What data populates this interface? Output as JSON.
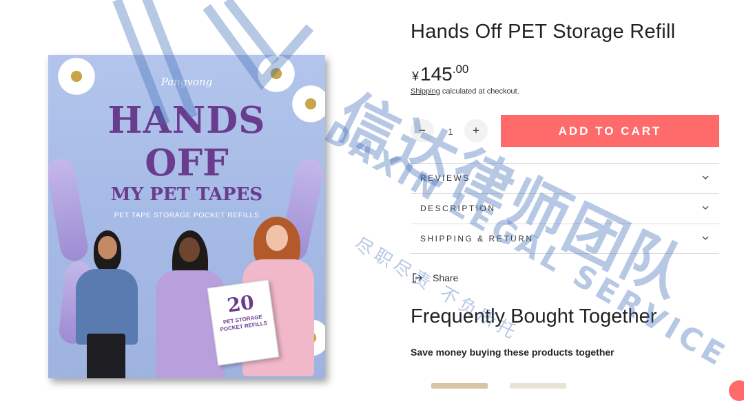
{
  "product": {
    "title": "Hands Off PET Storage Refill",
    "price": {
      "currency": "¥",
      "whole": "145",
      "decimal": ".00"
    },
    "shipping": {
      "link": "Shipping",
      "suffix": " calculated at checkout."
    },
    "quantity": "1",
    "qty_minus": "−",
    "qty_plus": "+",
    "add_to_cart": "ADD TO CART",
    "image": {
      "brand": "Pangvong",
      "title_line_1": "HANDS",
      "title_line_2": "OFF",
      "title_line_3": "MY PET TAPES",
      "subtitle": "PET TAPE STORAGE POCKET REFILLS",
      "refill_count": "20",
      "refill_label": "PET STORAGE POCKET REFILLS"
    }
  },
  "accordion": [
    {
      "label": "REVIEWS",
      "icon": "chevron-down-icon"
    },
    {
      "label": "DESCRIPTION",
      "icon": "chevron-down-icon"
    },
    {
      "label": "SHIPPING & RETURN",
      "icon": "chevron-down-icon"
    }
  ],
  "share": {
    "label": "Share",
    "icon": "share-icon"
  },
  "bought_together": {
    "title": "Frequently Bought Together",
    "subtitle": "Save money buying these products together"
  },
  "watermark": {
    "cn": "信达律师团队",
    "en": "DAXIN LEGAL SERVICE",
    "motto": "尽职尽责 不负所托"
  },
  "colors": {
    "accent": "#ff6b6b",
    "image_purple": "#6a3c8e",
    "watermark": "#426eb9"
  }
}
